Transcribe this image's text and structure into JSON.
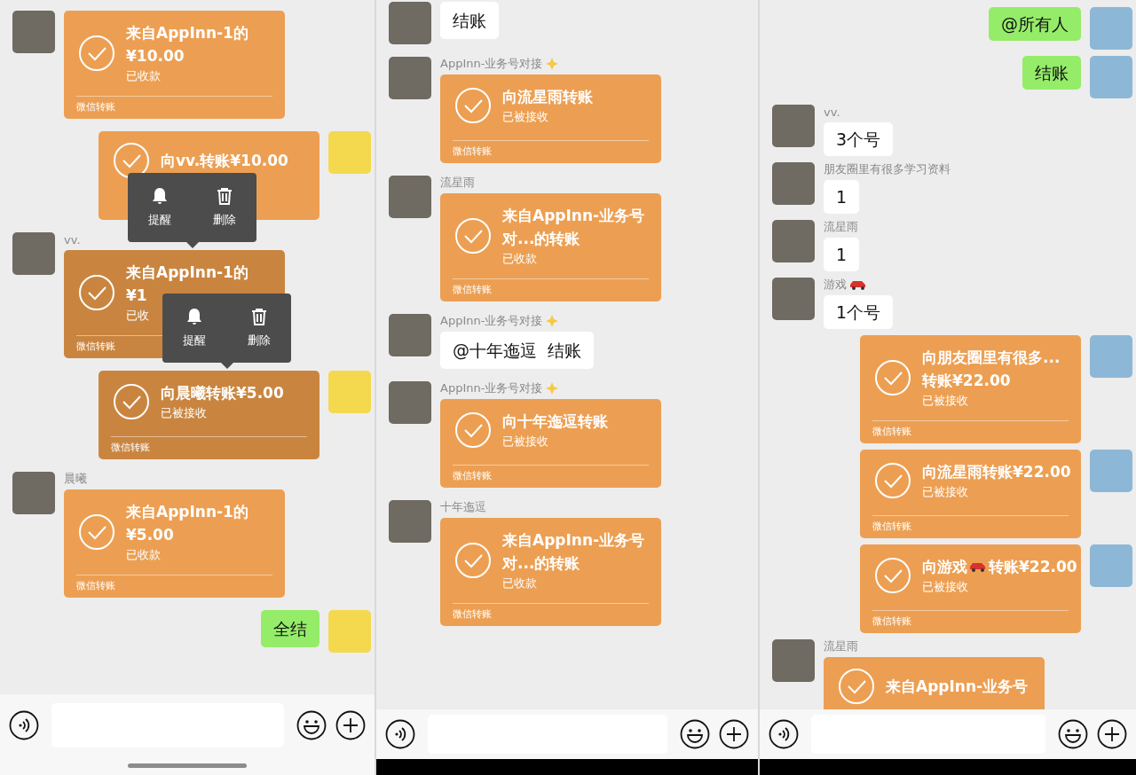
{
  "panels": [
    {
      "messages": [
        {
          "kind": "transfer",
          "outgoing": false,
          "pressed": false,
          "lines": [
            "来自AppInn-1的",
            "¥10.00"
          ],
          "status": "已收款",
          "footer": "微信转账"
        },
        {
          "kind": "transfer",
          "outgoing": true,
          "pressed": false,
          "lines": [
            "向vv.转账¥10.00"
          ]
        },
        {
          "kind": "transfer",
          "outgoing": false,
          "sender": "vv.",
          "pressed": true,
          "lines": [
            "来自AppInn-1的",
            "¥1"
          ],
          "status": "已收",
          "footer": "微信转账",
          "menu": [
            {
              "kind": "remind",
              "label": "提醒"
            },
            {
              "kind": "delete",
              "label": "删除"
            }
          ]
        },
        {
          "kind": "transfer",
          "outgoing": true,
          "pressed": true,
          "lines": [
            "向晨曦转账¥5.00"
          ],
          "status": "已被接收",
          "footer": "微信转账",
          "menu": [
            {
              "kind": "remind",
              "label": "提醒"
            },
            {
              "kind": "delete",
              "label": "删除"
            }
          ]
        },
        {
          "kind": "transfer",
          "outgoing": false,
          "sender": "晨曦",
          "pressed": false,
          "lines": [
            "来自AppInn-1的",
            "¥5.00"
          ],
          "status": "已收款",
          "footer": "微信转账"
        },
        {
          "kind": "text",
          "outgoing": true,
          "text": "全结"
        }
      ],
      "input_bar": {
        "home_indicator": true
      }
    },
    {
      "messages": [
        {
          "kind": "text",
          "outgoing": false,
          "text": "结账"
        },
        {
          "kind": "transfer",
          "outgoing": false,
          "sender": "AppInn-业务号对接",
          "sender_badge": {
            "kind": "sparkle"
          },
          "pressed": false,
          "lines": [
            "向流星雨转账"
          ],
          "status": "已被接收",
          "footer": "微信转账"
        },
        {
          "kind": "transfer",
          "outgoing": false,
          "sender": "流星雨",
          "pressed": false,
          "lines": [
            "来自AppInn-业务号",
            "对...的转账"
          ],
          "status": "已收款",
          "footer": "微信转账"
        },
        {
          "kind": "text",
          "outgoing": false,
          "sender": "AppInn-业务号对接",
          "sender_badge": {
            "kind": "sparkle"
          },
          "text": "@十年迤逗  结账"
        },
        {
          "kind": "transfer",
          "outgoing": false,
          "sender": "AppInn-业务号对接",
          "sender_badge": {
            "kind": "sparkle"
          },
          "pressed": false,
          "lines": [
            "向十年迤逗转账"
          ],
          "status": "已被接收",
          "footer": "微信转账"
        },
        {
          "kind": "transfer",
          "outgoing": false,
          "sender": "十年迤逗",
          "pressed": false,
          "lines": [
            "来自AppInn-业务号",
            "对...的转账"
          ],
          "status": "已收款",
          "footer": "微信转账"
        }
      ],
      "input_bar": {
        "bottom_strip": true
      }
    },
    {
      "messages": [
        {
          "kind": "text",
          "outgoing": true,
          "text": "@所有人"
        },
        {
          "kind": "text",
          "outgoing": true,
          "text": "结账"
        },
        {
          "kind": "text",
          "outgoing": false,
          "sender": "vv.",
          "text": "3个号"
        },
        {
          "kind": "text",
          "outgoing": false,
          "sender": "朋友圈里有很多学习资料",
          "text": "1"
        },
        {
          "kind": "text",
          "outgoing": false,
          "sender": "流星雨",
          "text": "1"
        },
        {
          "kind": "text",
          "outgoing": false,
          "sender": "游戏",
          "sender_badge": {
            "kind": "car"
          },
          "text": "1个号"
        },
        {
          "kind": "transfer",
          "outgoing": true,
          "pressed": false,
          "lines": [
            "向朋友圈里有很多...",
            "转账¥22.00"
          ],
          "status": "已被接收",
          "footer": "微信转账"
        },
        {
          "kind": "transfer",
          "outgoing": true,
          "pressed": false,
          "lines": [
            "向流星雨转账¥22.00"
          ],
          "status": "已被接收",
          "footer": "微信转账"
        },
        {
          "kind": "transfer",
          "outgoing": true,
          "pressed": false,
          "title_parts": [
            "向游戏",
            "转账¥22.00"
          ],
          "title_badge": {
            "kind": "car"
          },
          "status": "已被接收",
          "footer": "微信转账"
        },
        {
          "kind": "transfer",
          "outgoing": false,
          "sender": "流星雨",
          "pressed": false,
          "lines": [
            "来自AppInn-业务号"
          ]
        }
      ],
      "input_bar": {
        "bottom_strip": true
      }
    }
  ]
}
